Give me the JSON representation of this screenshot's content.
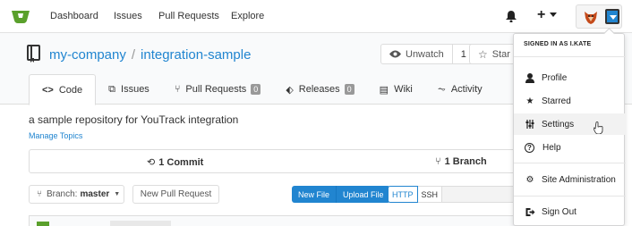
{
  "navbar": {
    "links": [
      "Dashboard",
      "Issues",
      "Pull Requests",
      "Explore"
    ],
    "plus_label": "+"
  },
  "repo": {
    "owner": "my-company",
    "separator": "/",
    "name": "integration-sample",
    "unwatch_label": "Unwatch",
    "watch_count": "1",
    "star_label": "Star",
    "description": "a sample repository for YouTrack integration",
    "manage_topics": "Manage Topics"
  },
  "tabs": [
    {
      "label": "Code",
      "icon": "code-icon"
    },
    {
      "label": "Issues",
      "icon": "issue-icon"
    },
    {
      "label": "Pull Requests",
      "icon": "pull-request-icon",
      "count": "0"
    },
    {
      "label": "Releases",
      "icon": "tag-icon",
      "count": "0"
    },
    {
      "label": "Wiki",
      "icon": "book-icon"
    },
    {
      "label": "Activity",
      "icon": "pulse-icon"
    }
  ],
  "stats": {
    "commits": "1 Commit",
    "branches": "1 Branch"
  },
  "toolbar": {
    "branch_prefix": "Branch:",
    "branch_name": "master",
    "new_pr": "New Pull Request",
    "new_file": "New File",
    "upload_file": "Upload File",
    "https": "HTTP",
    "ssh": "SSH"
  },
  "dropdown": {
    "header": "SIGNED IN AS I.KATE",
    "items": [
      {
        "label": "Profile",
        "icon": "person-icon"
      },
      {
        "label": "Starred",
        "icon": "star-icon"
      },
      {
        "label": "Settings",
        "icon": "settings-icon"
      },
      {
        "label": "Help",
        "icon": "help-icon"
      },
      {
        "label": "Site Administration",
        "icon": "server-icon"
      },
      {
        "label": "Sign Out",
        "icon": "sign-out-icon"
      }
    ]
  },
  "colors": {
    "accent": "#2185d0",
    "logo": "#5aa02c"
  }
}
